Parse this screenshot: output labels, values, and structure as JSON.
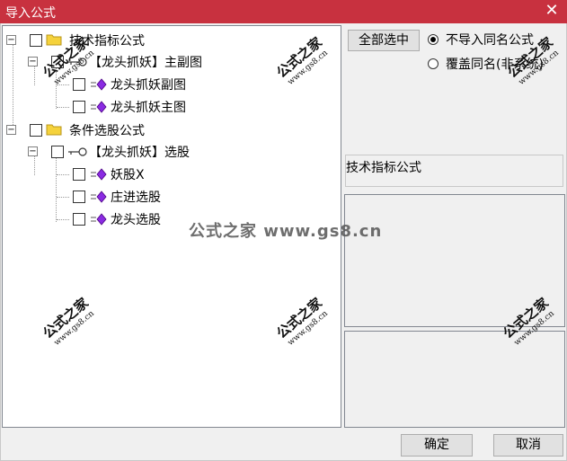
{
  "window": {
    "title": "导入公式",
    "close_glyph": "✕"
  },
  "tree": {
    "group1": {
      "label": "技术指标公式",
      "child": {
        "label": "【龙头抓妖】主副图",
        "items": [
          "龙头抓妖副图",
          "龙头抓妖主图"
        ]
      }
    },
    "group2": {
      "label": "条件选股公式",
      "child": {
        "label": "【龙头抓妖】选股",
        "items": [
          "妖股X",
          "庄进选股",
          "龙头选股"
        ]
      }
    },
    "expander_minus": "−"
  },
  "right_panel": {
    "select_all_label": "全部选中",
    "radio_skip_label": "不导入同名公式",
    "radio_overwrite_label": "覆盖同名(非系统)",
    "radio_selected": "skip",
    "category_label": "技术指标公式"
  },
  "watermark": {
    "text": "公式之家",
    "url": "www.gs8.cn",
    "center": "公式之家 www.gs8.cn"
  },
  "footer": {
    "ok_label": "确定",
    "cancel_label": "取消"
  },
  "colors": {
    "titlebar": "#c8313f",
    "folder": "#f5d23c",
    "formula_icon": "#8a2be2"
  },
  "icons": {
    "folder": "folder-icon",
    "key": "key-icon",
    "formula": "formula-icon",
    "close": "close-icon"
  }
}
